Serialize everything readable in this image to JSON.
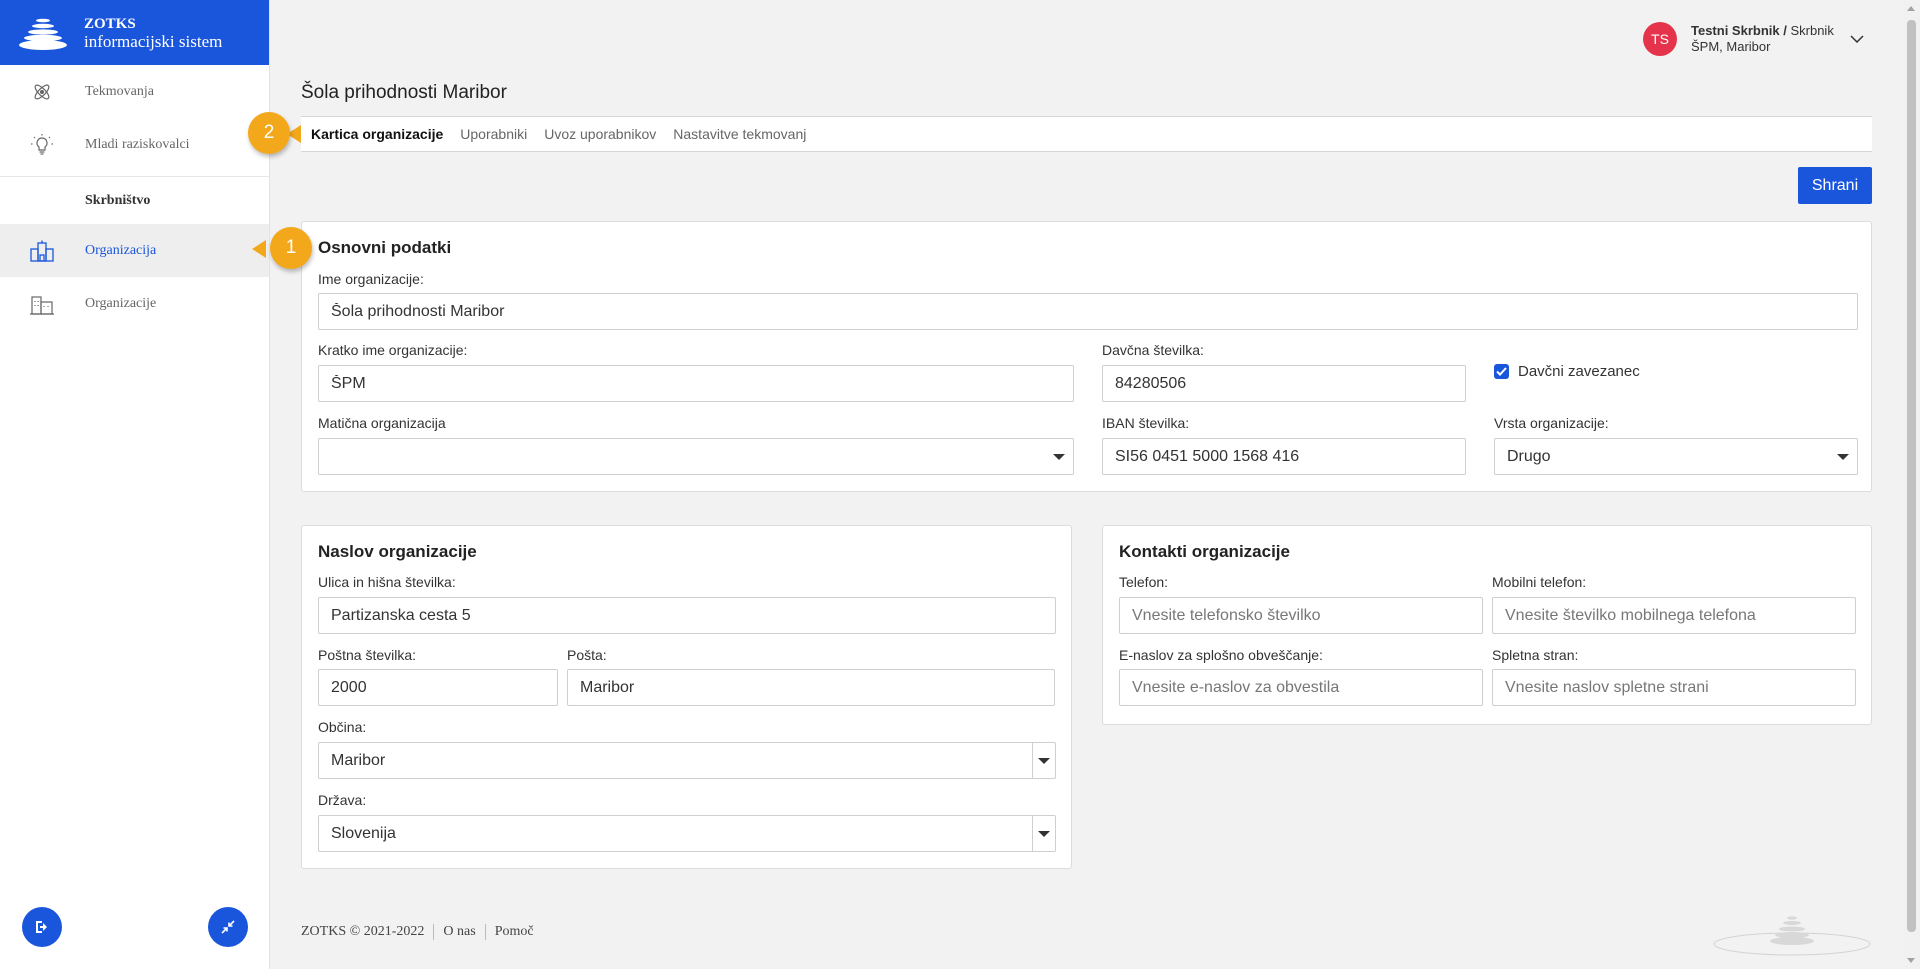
{
  "brand": {
    "title": "ZOTKS",
    "subtitle": "informacijski sistem"
  },
  "sidebar": {
    "items": [
      {
        "label": "Tekmovanja",
        "icon": "atom-icon"
      },
      {
        "label": "Mladi raziskovalci",
        "icon": "lightbulb-icon"
      }
    ],
    "section_label": "Skrbništvo",
    "section_items": [
      {
        "label": "Organizacija",
        "icon": "organization-icon",
        "active": true
      },
      {
        "label": "Organizacije",
        "icon": "buildings-icon"
      }
    ],
    "logout_icon": "logout-icon",
    "collapse_icon": "collapse-icon"
  },
  "user": {
    "initials": "TS",
    "name": "Testni Skrbnik /",
    "role": "Skrbnik",
    "org": "ŠPM, Maribor"
  },
  "page_title": "Šola prihodnosti Maribor",
  "tabs": [
    {
      "label": "Kartica organizacije",
      "active": true
    },
    {
      "label": "Uporabniki"
    },
    {
      "label": "Uvoz uporabnikov"
    },
    {
      "label": "Nastavitve tekmovanj"
    }
  ],
  "save_label": "Shrani",
  "basic": {
    "title": "Osnovni podatki",
    "name_label": "Ime organizacije:",
    "name_value": "Šola prihodnosti Maribor",
    "short_label": "Kratko ime organizacije:",
    "short_value": "ŠPM",
    "tax_label": "Davčna številka:",
    "tax_value": "84280506",
    "taxpayer_label": "Davčni zavezanec",
    "parent_label": "Matična organizacija",
    "parent_value": "",
    "iban_label": "IBAN številka:",
    "iban_value": "SI56 0451 5000 1568 416",
    "type_label": "Vrsta organizacije:",
    "type_value": "Drugo"
  },
  "address": {
    "title": "Naslov organizacije",
    "street_label": "Ulica in hišna številka:",
    "street_value": "Partizanska cesta 5",
    "postcode_label": "Poštna številka:",
    "postcode_value": "2000",
    "post_label": "Pošta:",
    "post_value": "Maribor",
    "municipality_label": "Občina:",
    "municipality_value": "Maribor",
    "country_label": "Država:",
    "country_value": "Slovenija"
  },
  "contacts": {
    "title": "Kontakti organizacije",
    "phone_label": "Telefon:",
    "phone_placeholder": "Vnesite telefonsko številko",
    "mobile_label": "Mobilni telefon:",
    "mobile_placeholder": "Vnesite številko mobilnega telefona",
    "email_label": "E-naslov za splošno obveščanje:",
    "email_placeholder": "Vnesite e-naslov za obvestila",
    "web_label": "Spletna stran:",
    "web_placeholder": "Vnesite naslov spletne strani"
  },
  "callouts": {
    "one": "1",
    "two": "2"
  },
  "footer": {
    "copyright": "ZOTKS © 2021-2022",
    "about": "O nas",
    "help": "Pomoč"
  },
  "colors": {
    "primary": "#1a56db",
    "avatar": "#e5334b",
    "callout": "#f3a81b"
  }
}
